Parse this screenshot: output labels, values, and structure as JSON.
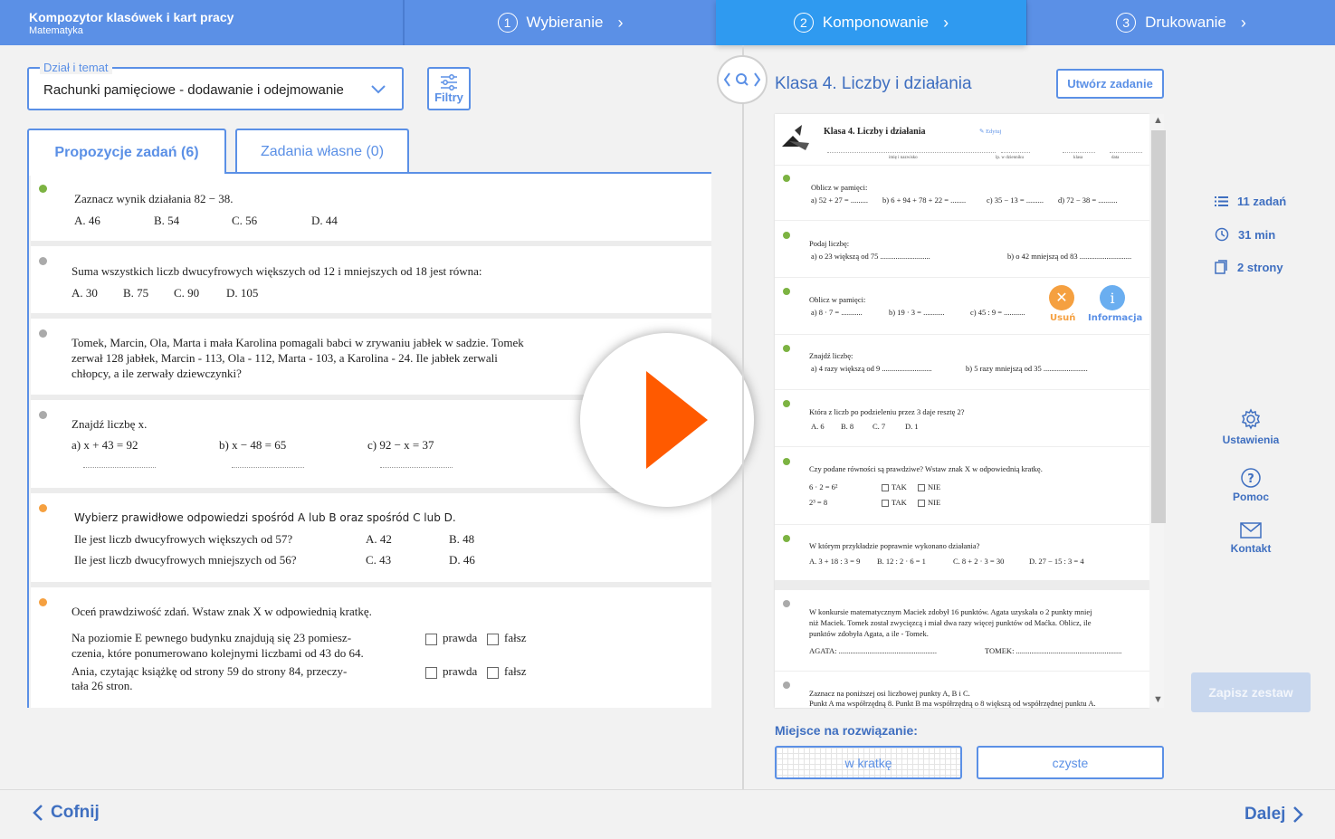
{
  "header": {
    "app_title": "Kompozytor klasówek i kart pracy",
    "app_subtitle": "Matematyka",
    "steps": [
      {
        "num": "1",
        "label": "Wybieranie"
      },
      {
        "num": "2",
        "label": "Komponowanie"
      },
      {
        "num": "3",
        "label": "Drukowanie"
      }
    ],
    "active_step": 2
  },
  "filter": {
    "legend": "Dział i temat",
    "value": "Rachunki pamięciowe - dodawanie i odejmowanie",
    "filters_label": "Filtry"
  },
  "tabs": {
    "proposals": "Propozycje zadań (6)",
    "own": "Zadania własne (0)"
  },
  "tasks": {
    "t1": {
      "q": "Zaznacz wynik działania 82 − 38.",
      "opts": [
        "A. 46",
        "B. 54",
        "C. 56",
        "D. 44"
      ]
    },
    "t2": {
      "q": "Suma wszystkich liczb dwucyfrowych większych od 12 i mniejszych od 18 jest równa:",
      "opts": [
        "A. 30",
        "B. 75",
        "C. 90",
        "D. 105"
      ]
    },
    "t3": {
      "lines": [
        "Tomek, Marcin, Ola, Marta i mała Karolina pomagali babci w zrywaniu jabłek w sadzie. Tomek",
        "zerwał 128 jabłek, Marcin - 113, Ola - 112, Marta - 103, a Karolina - 24. Ile jabłek zerwali",
        "chłopcy, a ile zerwały dziewczynki?"
      ]
    },
    "t4": {
      "q": "Znajdź liczbę x.",
      "parts": [
        "a) x + 43 = 92",
        "b) x − 48 = 65",
        "c) 92 − x = 37"
      ]
    },
    "t5": {
      "q": "Wybierz prawidłowe odpowiedzi spośród A lub B oraz spośród C lub D.",
      "r1": "Ile jest liczb dwucyfrowych większych od 57?",
      "r1a": "A.  42",
      "r1b": "B.  48",
      "r2": "Ile jest liczb dwucyfrowych mniejszych od 56?",
      "r2a": "C.  43",
      "r2b": "D.  46"
    },
    "t6": {
      "q": "Oceń prawdziwość zdań. Wstaw znak X w odpowiednią kratkę.",
      "s1a": "Na poziomie E pewnego budynku znajdują się 23 pomiesz-",
      "s1b": "czenia, które ponumerowano kolejnymi liczbami od 43 do 64.",
      "s2a": "Ania, czytając książkę od strony 59 do strony 84, przeczy-",
      "s2b": "tała 26 stron.",
      "true_lbl": "prawda",
      "false_lbl": "fałsz"
    }
  },
  "doc": {
    "title": "Klasa 4. Liczby i działania",
    "create_task": "Utwórz zadanie"
  },
  "preview": {
    "title": "Klasa 4. Liczby i działania",
    "edit": "Edytuj",
    "fields": [
      "imię i nazwisko",
      "lp. w dzienniku",
      "klasa",
      "data"
    ],
    "p1": {
      "q": "Oblicz w pamięci:",
      "a": "a) 52 + 27 = .........",
      "b": "b) 6 + 94 + 78 + 22 = ........",
      "c": "c) 35 − 13 = .........",
      "d": "d) 72 − 38 = .........."
    },
    "p2": {
      "q": "Podaj liczbę:",
      "a": "a) o 23 większą od 75 ..........................",
      "b": "b) o 42 mniejszą od 83 ..........................."
    },
    "p3": {
      "q": "Oblicz w pamięci:",
      "a": "a) 8 · 7 = ...........",
      "b": "b) 19 · 3 = ...........",
      "c": "c) 45 : 9 = ..........."
    },
    "p4": {
      "q": "Znajdź liczbę:",
      "a": "a) 4 razy większą od 9 ..........................",
      "b": "b) 5 razy mniejszą od 35 ......................."
    },
    "p5": {
      "q": "Która z liczb po podzieleniu przez 3 daje resztę 2?",
      "a": "A. 6",
      "b": "B. 8",
      "c": "C. 7",
      "d": "D. 1"
    },
    "p6": {
      "q": "Czy podane równości są prawdziwe? Wstaw znak X w odpowiednią kratkę.",
      "e1": "6 · 2 = 6²",
      "e2": "2³ = 8",
      "yes": "TAK",
      "no": "NIE"
    },
    "p7": {
      "q": "W którym przykładzie poprawnie wykonano działania?",
      "a": "A. 3 + 18 : 3 = 9",
      "b": "B. 12 : 2 · 6 = 1",
      "c": "C. 8 + 2 · 3 = 30",
      "d": "D. 27 − 15 : 3 = 4"
    },
    "p8": {
      "l1": "W konkursie matematycznym Maciek zdobył 16 punktów. Agata uzyskała o 2 punkty mniej",
      "l2": "niż Maciek. Tomek został zwycięzcą i miał dwa razy więcej punktów od Maćka. Oblicz, ile",
      "l3": "punktów zdobyła Agata, a ile - Tomek.",
      "agata": "AGATA: ...................................................",
      "tomek": "TOMEK: ......................................................."
    },
    "p9": {
      "l1": "Zaznacz na poniższej osi liczbowej punkty A, B i C.",
      "l2": "Punkt A ma współrzędną 8. Punkt B ma współrzędną o 8 większą od współrzędnej punktu A."
    },
    "remove": "Usuń",
    "info": "Informacja"
  },
  "stats": {
    "tasks": "11 zadań",
    "time": "31 min",
    "pages": "2 strony"
  },
  "side": {
    "settings": "Ustawienia",
    "help": "Pomoc",
    "contact": "Kontakt",
    "save": "Zapisz zestaw"
  },
  "solution": {
    "label": "Miejsce na rozwiązanie:",
    "grid": "w kratkę",
    "clean": "czyste"
  },
  "nav": {
    "back": "Cofnij",
    "next": "Dalej"
  },
  "colors": {
    "primary": "#5b90e6",
    "active_step": "#2f9af0",
    "play": "#ff5a00",
    "remove": "#f5a040",
    "info": "#6aaef0"
  }
}
